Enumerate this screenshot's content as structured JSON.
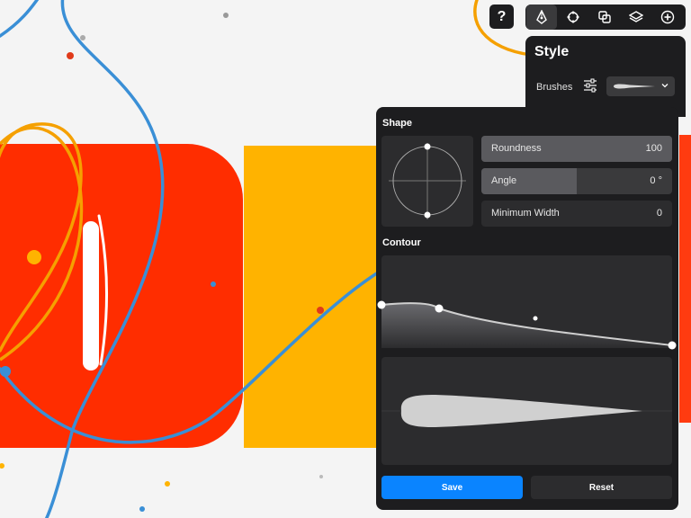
{
  "colors": {
    "accent": "#0a84ff",
    "panel": "#1d1d1f",
    "art_red": "#ff2d00",
    "art_yellow": "#ffb300",
    "art_blue": "#3a8fd6",
    "art_orange_line": "#f5a000"
  },
  "toolbar": {
    "help_label": "?",
    "tools": [
      {
        "icon": "pen-nib-icon",
        "active": true
      },
      {
        "icon": "transform-icon",
        "active": false
      },
      {
        "icon": "shapes-icon",
        "active": false
      },
      {
        "icon": "layers-icon",
        "active": false
      },
      {
        "icon": "add-icon",
        "active": false
      }
    ]
  },
  "style": {
    "title": "Style",
    "brushes_label": "Brushes"
  },
  "brush": {
    "shape_title": "Shape",
    "contour_title": "Contour",
    "params": {
      "roundness": {
        "label": "Roundness",
        "value": "100",
        "level": 1.0
      },
      "angle": {
        "label": "Angle",
        "value": "0 °",
        "level": 0.5
      },
      "min_width": {
        "label": "Minimum Width",
        "value": "0",
        "level": 0.0
      }
    },
    "save_label": "Save",
    "reset_label": "Reset"
  }
}
